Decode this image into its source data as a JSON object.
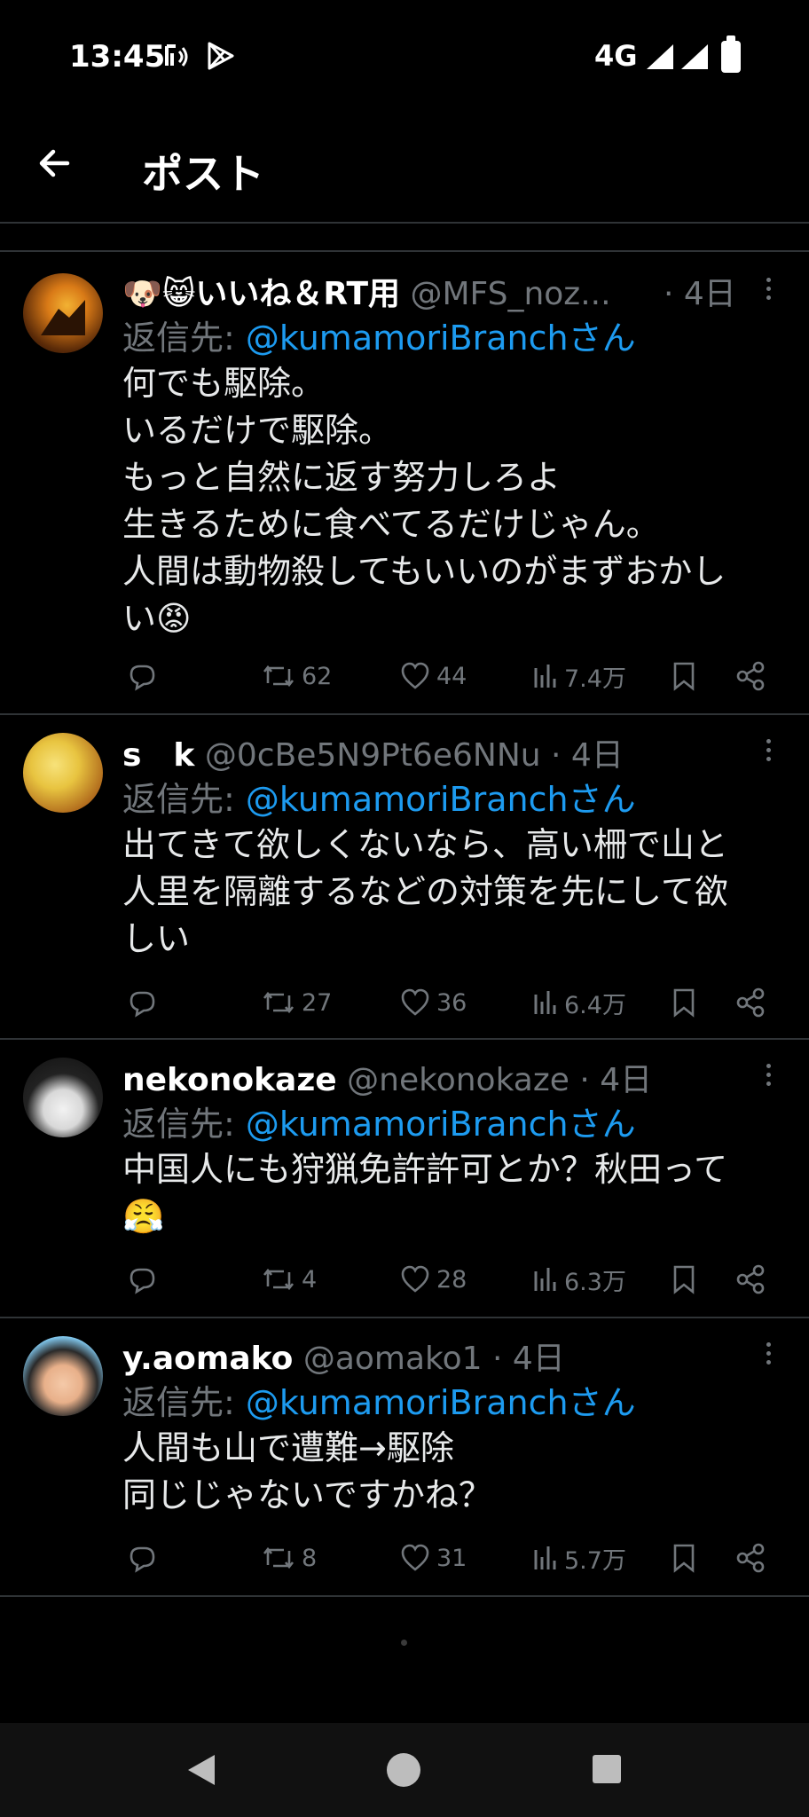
{
  "status": {
    "time": "13:45",
    "network": "4G"
  },
  "header": {
    "title": "ポスト"
  },
  "posts": [
    {
      "name": "🐶😸いいね＆RT用",
      "handle": "@MFS_noz...",
      "date": "· 4日",
      "reply_label": "返信先: ",
      "reply_to": "@kumamoriBranchさん",
      "lines": [
        "何でも駆除。",
        "いるだけで駆除。",
        "もっと自然に返す努力しろよ",
        "生きるために食べてるだけじゃん。",
        "人間は動物殺してもいいのがまずおかし",
        "い😡"
      ],
      "retweets": "62",
      "likes": "44",
      "views": "7.4万"
    },
    {
      "name": "s　k",
      "handle": "@0cBe5N9Pt6e6NNu",
      "date": "· 4日",
      "reply_label": "返信先: ",
      "reply_to": "@kumamoriBranchさん",
      "lines": [
        "出てきて欲しくないなら、高い柵で山と",
        "人里を隔離するなどの対策を先にして欲",
        "しい"
      ],
      "retweets": "27",
      "likes": "36",
      "views": "6.4万"
    },
    {
      "name": "nekonokaze",
      "handle": "@nekonokaze",
      "date": "· 4日",
      "reply_label": "返信先: ",
      "reply_to": "@kumamoriBranchさん",
      "lines": [
        "中国人にも狩猟免許許可とか？秋田って",
        "😤"
      ],
      "retweets": "4",
      "likes": "28",
      "views": "6.3万"
    },
    {
      "name": "y.aomako",
      "handle": "@aomako1",
      "date": "· 4日",
      "reply_label": "返信先: ",
      "reply_to": "@kumamoriBranchさん",
      "lines": [
        "人間も山で遭難→駆除",
        "同じじゃないですかね？"
      ],
      "retweets": "8",
      "likes": "31",
      "views": "5.7万"
    }
  ],
  "colors": {
    "background": "#000000",
    "text": "#e7e9ea",
    "muted": "#71767b",
    "mention": "#1d9bf0",
    "divider": "#2f3336"
  },
  "icons": [
    "back-arrow-icon",
    "reply-icon",
    "retweet-icon",
    "like-icon",
    "views-icon",
    "bookmark-icon",
    "share-icon",
    "more-icon",
    "nav-back-icon",
    "nav-home-icon",
    "nav-recents-icon"
  ]
}
